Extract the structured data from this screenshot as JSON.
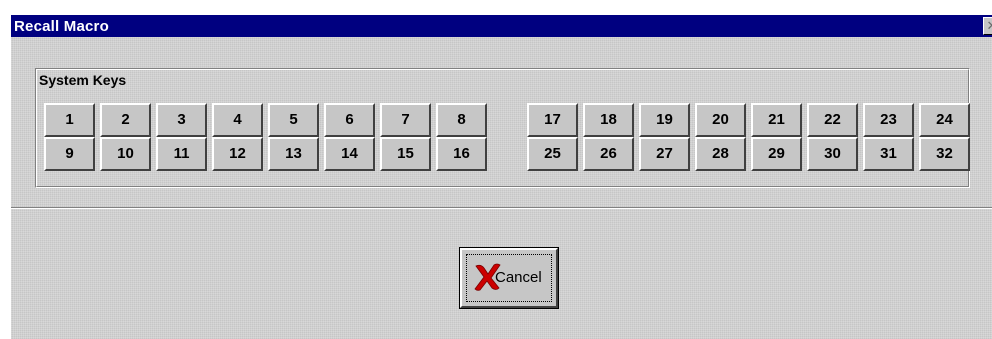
{
  "window": {
    "title": "Recall Macro",
    "close_glyph": "✕"
  },
  "system_keys": {
    "label": "System Keys",
    "keys": [
      "1",
      "2",
      "3",
      "4",
      "5",
      "6",
      "7",
      "8",
      "9",
      "10",
      "11",
      "12",
      "13",
      "14",
      "15",
      "16",
      "17",
      "18",
      "19",
      "20",
      "21",
      "22",
      "23",
      "24",
      "25",
      "26",
      "27",
      "28",
      "29",
      "30",
      "31",
      "32"
    ]
  },
  "cancel_button": {
    "label": "Cancel",
    "icon": "red-x-icon"
  },
  "colors": {
    "titlebar": "#000080",
    "face": "#c6c6c6",
    "cancel_x": "#cc0000"
  }
}
